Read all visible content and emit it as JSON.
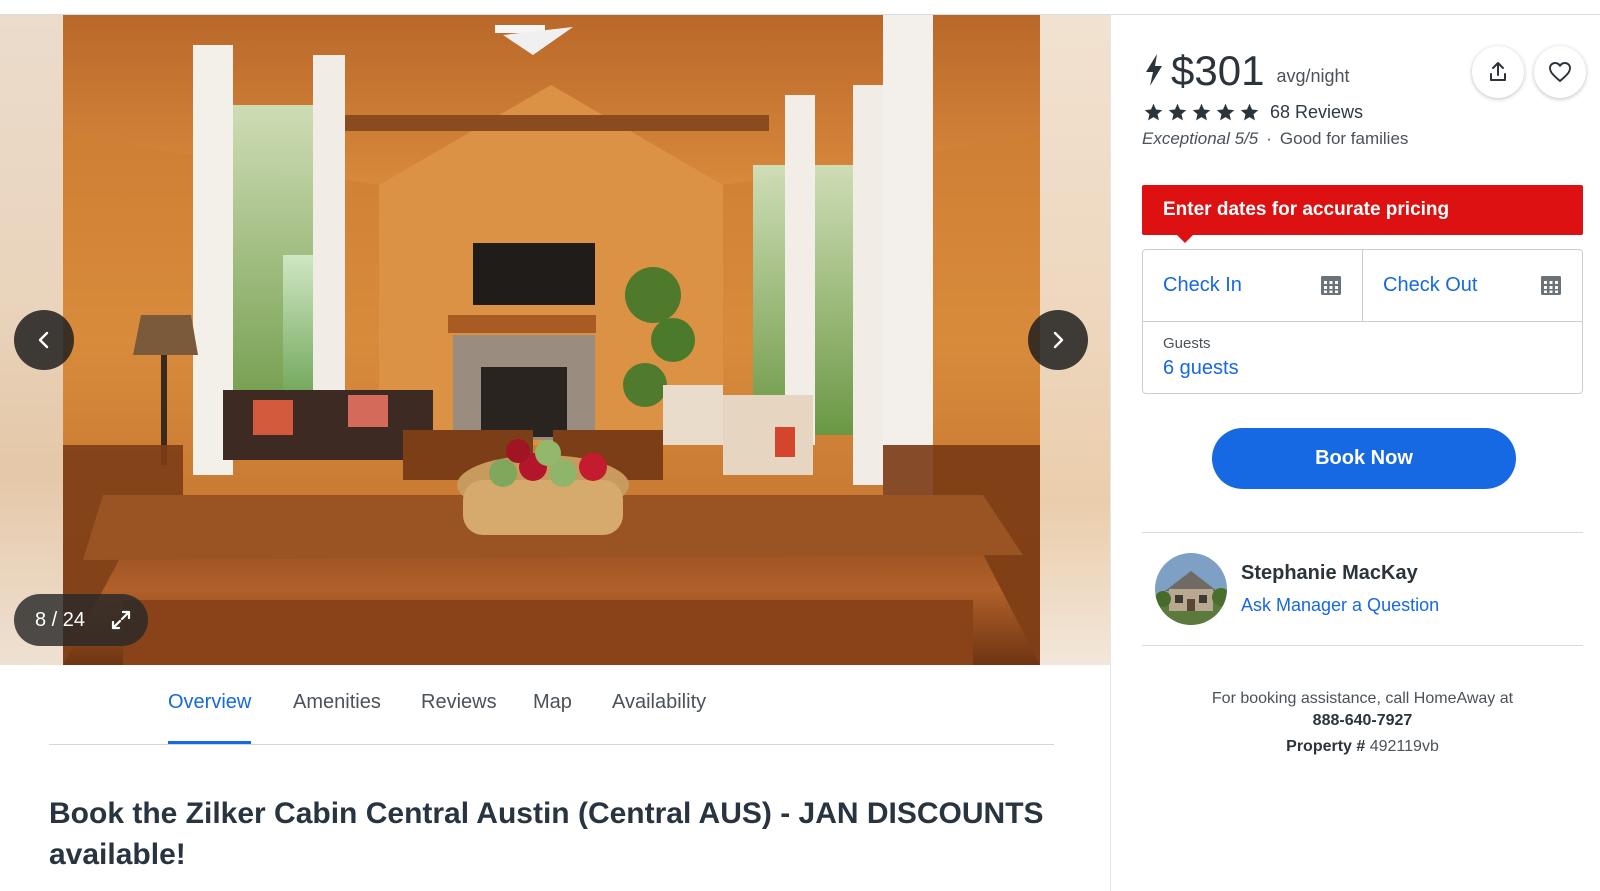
{
  "gallery": {
    "counter": "8 / 24",
    "current_index": 8,
    "total": 24,
    "prev_icon": "chevron-left-icon",
    "next_icon": "chevron-right-icon",
    "expand_icon": "expand-icon"
  },
  "tabs": [
    {
      "label": "Overview",
      "active": true
    },
    {
      "label": "Amenities",
      "active": false
    },
    {
      "label": "Reviews",
      "active": false
    },
    {
      "label": "Map",
      "active": false
    },
    {
      "label": "Availability",
      "active": false
    }
  ],
  "listing": {
    "title": "Book the Zilker Cabin Central Austin (Central AUS) - JAN DISCOUNTS available!"
  },
  "booking": {
    "price": "$301",
    "price_unit": "avg/night",
    "reviews": "68 Reviews",
    "stars": 5,
    "rating_score": "Exceptional 5/5",
    "separator": "·",
    "rating_note": "Good for families",
    "alert": "Enter dates for accurate pricing",
    "check_in": "Check In",
    "check_out": "Check Out",
    "guests_label": "Guests",
    "guests_value": "6 guests",
    "book_button": "Book Now"
  },
  "manager": {
    "name": "Stephanie MacKay",
    "ask_link": "Ask Manager a Question"
  },
  "assistance": {
    "text": "For booking assistance, call HomeAway at",
    "phone": "888-640-7927",
    "property_label": "Property #",
    "property_id": "492119vb"
  },
  "colors": {
    "accent": "#1668e3",
    "alert": "#dd1111",
    "text": "#2f3941"
  }
}
